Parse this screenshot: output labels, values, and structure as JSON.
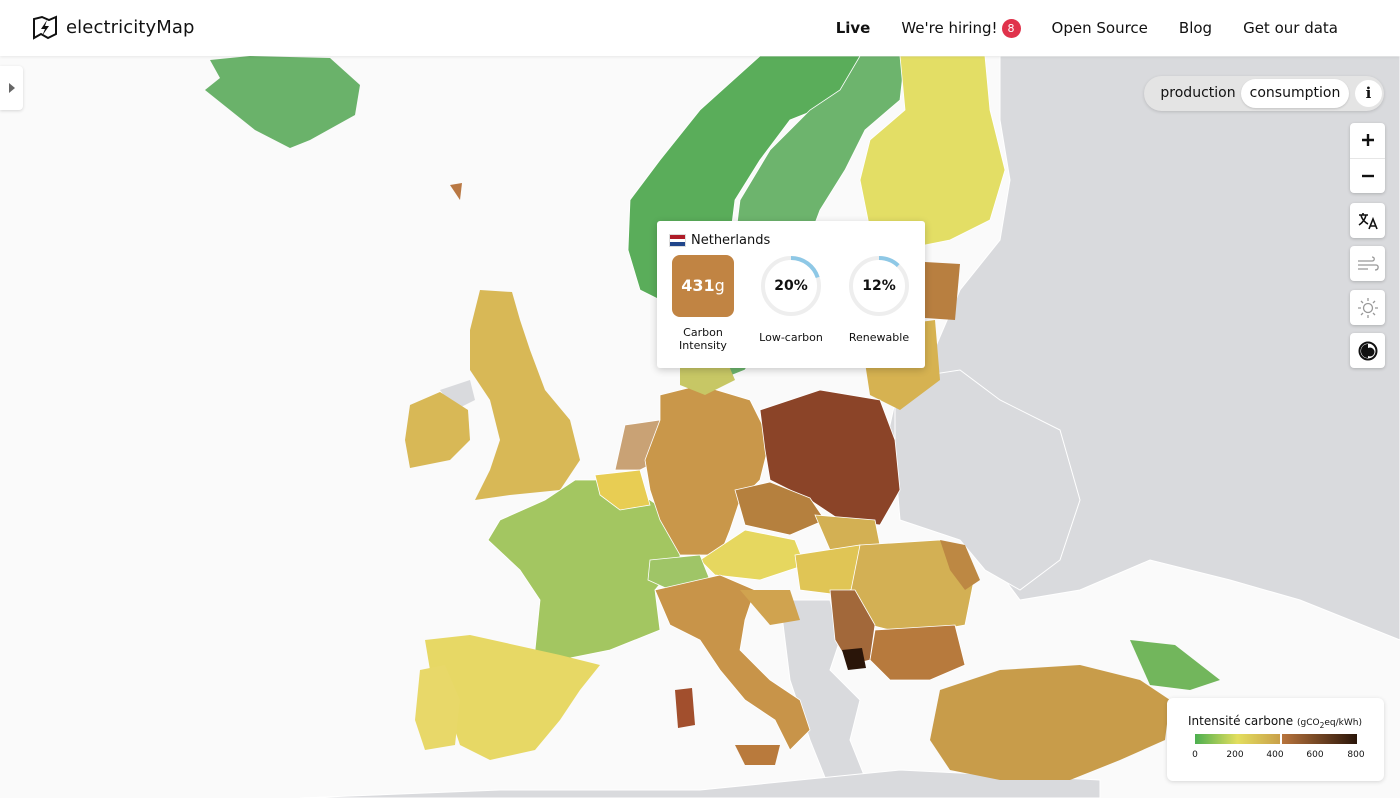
{
  "header": {
    "logo_text": "electricityMap",
    "nav": [
      {
        "label": "Live",
        "active": true
      },
      {
        "label": "We're hiring!",
        "badge": "8"
      },
      {
        "label": "Open Source"
      },
      {
        "label": "Blog"
      },
      {
        "label": "Get our data"
      }
    ]
  },
  "mode_toggle": {
    "production_label": "production",
    "consumption_label": "consumption",
    "info_label": "i",
    "selected": "consumption"
  },
  "controls": [
    {
      "name": "zoom-in",
      "icon": "plus-icon"
    },
    {
      "name": "zoom-out",
      "icon": "minus-icon"
    },
    {
      "name": "language",
      "icon": "translate-icon"
    },
    {
      "name": "wind-layer",
      "icon": "wind-icon"
    },
    {
      "name": "solar-layer",
      "icon": "sun-icon"
    },
    {
      "name": "dark-mode",
      "icon": "contrast-icon"
    }
  ],
  "tooltip": {
    "country": "Netherlands",
    "carbon_intensity_value": "431",
    "carbon_intensity_unit": "g",
    "carbon_intensity_label": "Carbon Intensity",
    "low_carbon_pct": "20%",
    "low_carbon_fraction": 0.2,
    "low_carbon_label": "Low-carbon",
    "renewable_pct": "12%",
    "renewable_fraction": 0.12,
    "renewable_label": "Renewable",
    "box_color": "#c18443"
  },
  "legend": {
    "title": "Intensité carbone",
    "unit_prefix": "(gCO",
    "unit_sub": "2",
    "unit_suffix": "eq/kWh)",
    "ticks": [
      "0",
      "200",
      "400",
      "600",
      "800"
    ]
  },
  "colors": {
    "low": "#5aa75a",
    "mid": "#e3dd63",
    "high": "#c7a04e",
    "very_high": "#8b3e24",
    "extreme": "#2a1509",
    "gauge": "#8ec8e6"
  }
}
